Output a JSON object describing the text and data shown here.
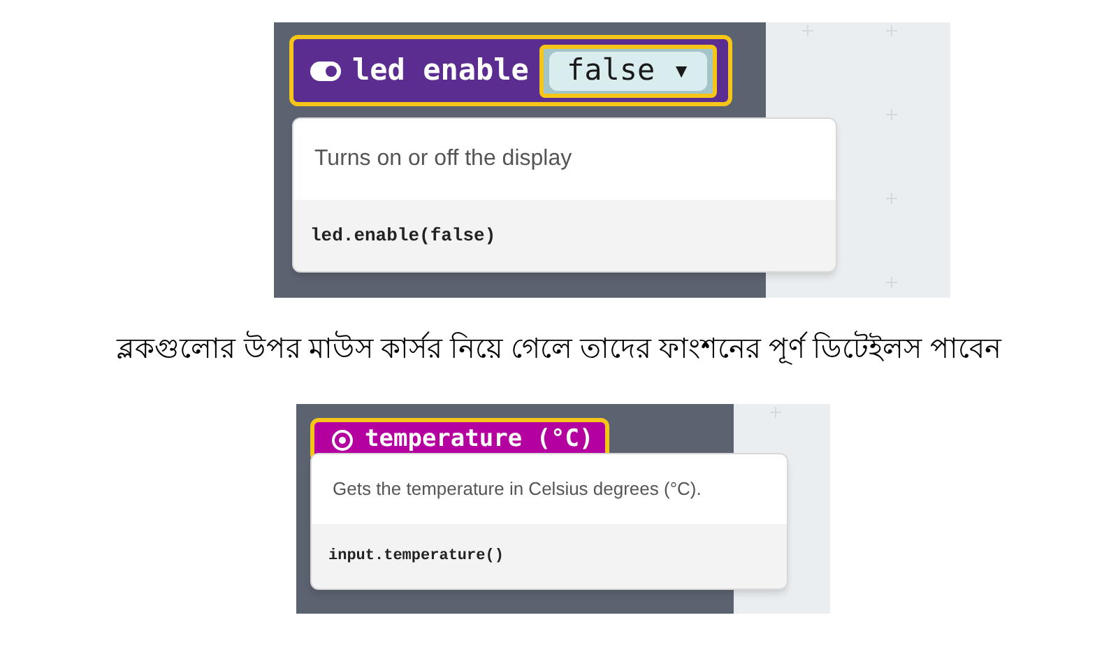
{
  "figures": [
    {
      "block": {
        "kind": "toggle",
        "label": "led enable",
        "dropdown": "false ▾",
        "color": "#5c2d91"
      },
      "tooltip": {
        "description": "Turns on or off the display",
        "code": "led.enable(false)"
      }
    },
    {
      "block": {
        "kind": "target",
        "label": "temperature (°C)",
        "color": "#b4009e"
      },
      "tooltip": {
        "description": "Gets the temperature in Celsius degrees (°C).",
        "code": "input.temperature()"
      }
    }
  ],
  "caption": "ব্লকগুলোর উপর মাউস কার্সর নিয়ে গেলে তাদের ফাংশনের পূর্ণ ডিটেইলস পাবেন"
}
